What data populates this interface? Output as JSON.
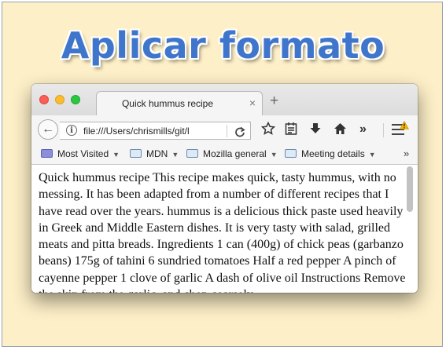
{
  "heading": "Aplicar formato",
  "browser": {
    "tab": {
      "title": "Quick hummus recipe",
      "close": "×"
    },
    "new_tab": "+",
    "back": "←",
    "url": "file:///Users/chrismills/git/l",
    "reload": "C",
    "overflow": "»",
    "bookmarks": [
      {
        "label": "Most Visited"
      },
      {
        "label": "MDN"
      },
      {
        "label": "Mozilla general"
      },
      {
        "label": "Meeting details"
      }
    ],
    "bookmarks_more": "»"
  },
  "page": {
    "text": "Quick hummus recipe This recipe makes quick, tasty hummus, with no messing. It has been adapted from a number of different recipes that I have read over the years. hummus is a delicious thick paste used heavily in Greek and Middle Eastern dishes. It is very tasty with salad, grilled meats and pitta breads. Ingredients 1 can (400g) of chick peas (garbanzo beans) 175g of tahini 6 sundried tomatoes Half a red pepper A pinch of cayenne pepper 1 clove of garlic A dash of olive oil Instructions Remove the skin from the garlic, and chop coarsely"
  },
  "colors": {
    "background": "#fdefc7",
    "heading": "#3f76cc",
    "window_chrome": "#f5f5f5"
  }
}
